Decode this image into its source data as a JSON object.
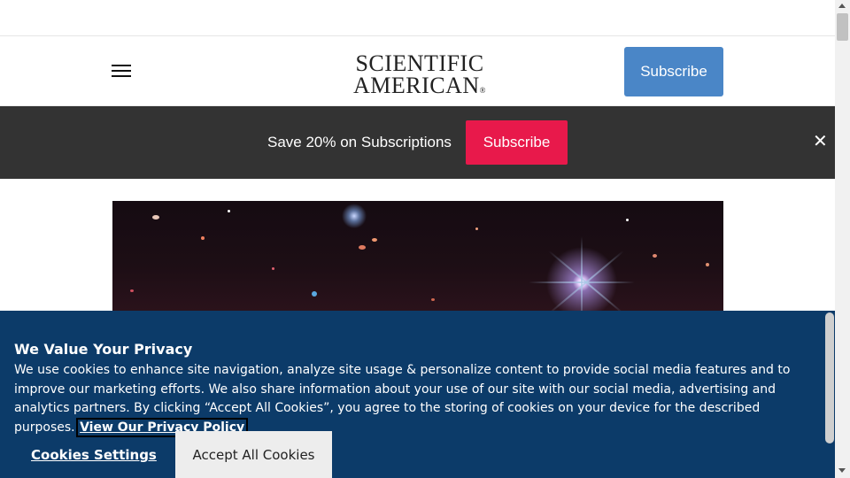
{
  "header": {
    "logo_line1": "SCIENTIFIC",
    "logo_line2": "AMERICAN",
    "logo_mark": "®",
    "subscribe_label": "Subscribe",
    "menu_icon": "hamburger-menu-icon"
  },
  "promo": {
    "text": "Save 20% on Subscriptions",
    "subscribe_label": "Subscribe",
    "close_glyph": "✕"
  },
  "cookie_banner": {
    "title": "We Value Your Privacy",
    "body": "We use cookies to enhance site navigation, analyze site usage & personalize content to provide social media features and to improve our marketing efforts. We also share information about your use of our site with our social media, advertising and analytics partners. By clicking “Accept All Cookies”, you agree to the storing of cookies on your device for the described purposes.",
    "policy_link": "View Our Privacy Policy",
    "settings_label": "Cookies Settings",
    "accept_label": "Accept All Cookies"
  },
  "colors": {
    "header_subscribe": "#4a86c7",
    "promo_bg": "#333333",
    "promo_subscribe": "#e8194b",
    "cookie_bg": "#0c3b69"
  }
}
